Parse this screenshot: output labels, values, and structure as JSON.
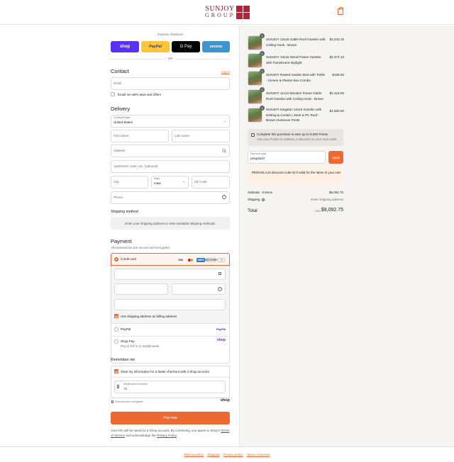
{
  "header": {
    "logo_line1": "SUNJOY",
    "logo_line2": "GROUP"
  },
  "express": {
    "label": "Express checkout",
    "shop": "shop",
    "paypal": "PayPal",
    "gpay": "G Pay",
    "venmo": "venmo",
    "or": "OR"
  },
  "contact": {
    "title": "Contact",
    "login": "Log in",
    "email_placeholder": "Email",
    "news_label": "Email me with news and offers"
  },
  "delivery": {
    "title": "Delivery",
    "country_label": "Country/Region",
    "country_value": "United States",
    "first_name": "First name",
    "last_name": "Last name",
    "address": "Address",
    "apartment": "Apartment, suite, etc. (optional)",
    "city": "City",
    "state_label": "State",
    "state_value": "Iowa",
    "zip": "ZIP code",
    "phone": "Phone"
  },
  "shipping_method": {
    "title": "Shipping method",
    "message": "Enter your shipping address to view available shipping methods."
  },
  "payment": {
    "title": "Payment",
    "subtitle": "All transactions are secure and encrypted.",
    "credit_card": "Credit card",
    "cards": [
      "VISA",
      "MC",
      "AMEX",
      "DISCOVER"
    ],
    "more": "+5",
    "billing_label": "Use shipping address as billing address",
    "paypal": "PayPal",
    "paypal_logo": "PayPal",
    "shop_pay": "Shop Pay",
    "shop_pay_sub": "Pay in full or in installments",
    "shop_logo": "shop"
  },
  "remember": {
    "title": "Remember me",
    "save_label": "Save my information for a faster checkout with a Shop account",
    "mobile_label": "Mobile phone number",
    "mobile_value": "+1",
    "secure": "Secured and encrypted",
    "shop_logo": "shop"
  },
  "pay_now": "Pay now",
  "legal": {
    "line1": "Your info will be saved to a Shop account. By continuing, you agree to Shop's",
    "terms": "Terms of Service",
    "and": "and acknowledge the",
    "privacy": "Privacy Policy",
    "end": "."
  },
  "footer": {
    "links": [
      "Refund policy",
      "Shipping",
      "Privacy policy",
      "Terms of service"
    ]
  },
  "order": {
    "items": [
      {
        "qty": "1",
        "name": "SUNJOY 13x15 Gable Roof Gazebo with Ceiling Hook - Brown",
        "price": "$2,243.15"
      },
      {
        "qty": "1",
        "name": "SUNJOY 13x15 Wood Frame Gazebo with Translucent Skylight",
        "price": "$2,474.10"
      },
      {
        "qty": "1",
        "name": "SUNJOY Raised Garden Bed with Trellis - Screen & Planter Box Combo",
        "price": "$136.50"
      },
      {
        "qty": "1",
        "name": "SUNJOY 11x13 Wooden Frame Gable Roof Gazebo with Ceiling Hook - Brown",
        "price": "$2,419.00"
      },
      {
        "qty": "1",
        "name": "SUNJOY Kingston 12x16 Gazebo with Netting & Curtain | Steel & PC Roof - Brown Aluminum Posts",
        "price": "$1,820.00"
      }
    ],
    "points_title": "Complete this purchase to earn up to 9,092 Points",
    "points_sub": "Use your Points to redeem a discount on your next order.",
    "discount_label": "Discount code",
    "discount_value": "pergola10",
    "apply": "Apply",
    "discount_error": "PERGOLA10 discount code isn't valid for the items in your cart",
    "subtotal_label": "Subtotal · 5 items",
    "subtotal_value": "$9,092.75",
    "shipping_label": "Shipping",
    "shipping_value": "Enter shipping address",
    "total_label": "Total",
    "currency": "USD",
    "total_value": "$9,092.75"
  },
  "colors": {
    "accent": "#ec6a31",
    "shop": "#5a31f4",
    "paypal": "#ffc439",
    "venmo": "#3d95ce",
    "brand": "#b0243a"
  }
}
